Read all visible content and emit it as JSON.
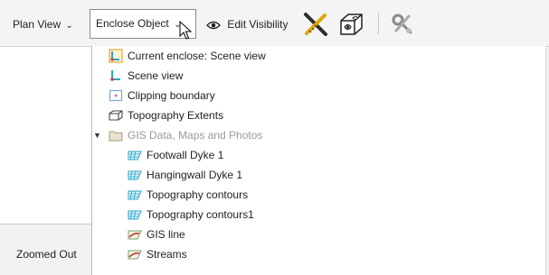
{
  "toolbar": {
    "plan_view_label": "Plan View",
    "enclose_label": "Enclose Object",
    "edit_visibility_label": "Edit Visibility",
    "tool_icons": [
      "ruler-cross-icon",
      "3d-box-eye-icon",
      "settings-tools-icon"
    ]
  },
  "dropdown": {
    "items": [
      {
        "label": "Current enclose: Scene view",
        "icon": "enclose-current-icon"
      },
      {
        "label": "Scene view",
        "icon": "scene-axes-icon"
      },
      {
        "label": "Clipping boundary",
        "icon": "clipping-boundary-icon"
      },
      {
        "label": "Topography Extents",
        "icon": "topography-extents-icon"
      },
      {
        "label": "GIS Data, Maps and Photos",
        "icon": "folder-icon"
      },
      {
        "label": "Footwall Dyke 1",
        "icon": "surface-mesh-icon"
      },
      {
        "label": "Hangingwall Dyke 1",
        "icon": "surface-mesh-icon"
      },
      {
        "label": "Topography contours",
        "icon": "surface-mesh-icon"
      },
      {
        "label": "Topography contours1",
        "icon": "surface-mesh-icon"
      },
      {
        "label": "GIS line",
        "icon": "gis-line-icon"
      },
      {
        "label": "Streams",
        "icon": "gis-line-icon"
      }
    ]
  },
  "status": {
    "zoomed_label": "Zoomed Out"
  },
  "colors": {
    "toolbar_bg": "#f4f4f4",
    "accent_cyan": "#2aa6c9",
    "muted_text": "#9a9a9a"
  }
}
